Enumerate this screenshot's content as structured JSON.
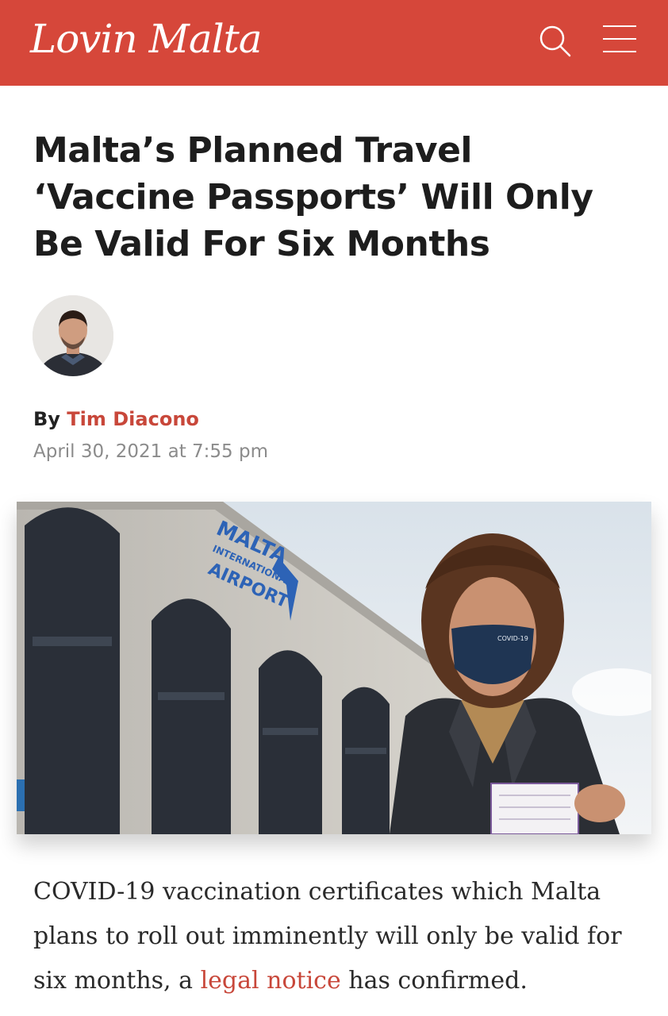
{
  "header": {
    "logo_text": "Lovin Malta",
    "brand_color": "#d6473a",
    "search_icon": "search-icon",
    "menu_icon": "hamburger-menu-icon"
  },
  "article": {
    "title": "Malta’s Planned Travel ‘Vaccine Passports’ Will Only Be Valid For Six Months",
    "byline_prefix": "By",
    "author": "Tim Diacono",
    "date": "April 30, 2021 at 7:55 pm",
    "hero_image": {
      "sign_line1": "MALTA",
      "sign_line2": "INTERNATIONAL",
      "sign_line3": "AIRPORT",
      "mask_text": "COVID-19"
    },
    "paragraph_before_link": "COVID-19 vaccination certificates which Malta plans to roll out imminently will only be valid for six months, a",
    "link_text": "legal notice",
    "paragraph_after_link": "has confirmed."
  }
}
